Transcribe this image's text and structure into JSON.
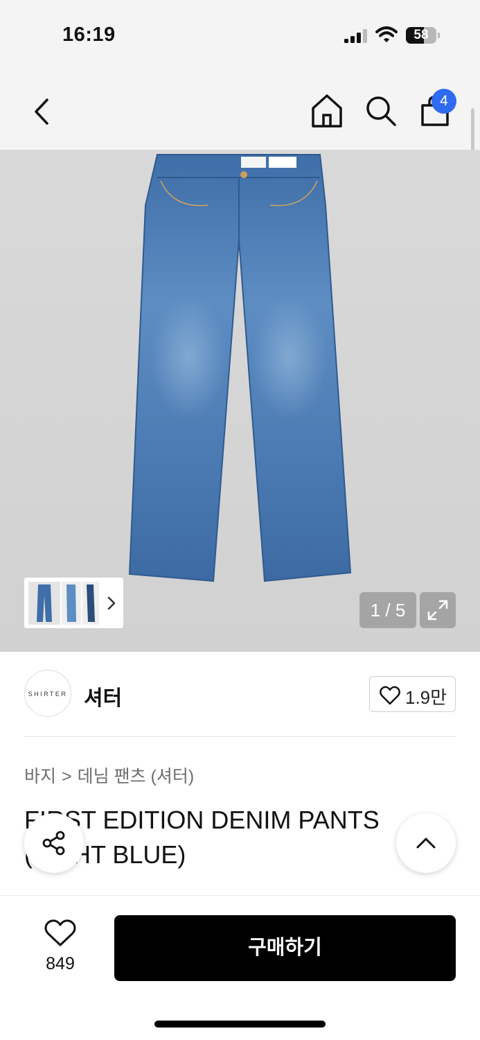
{
  "status_bar": {
    "time": "16:19",
    "battery_percent": "58",
    "battery_level": 0.58,
    "icons": [
      "signal-icon",
      "wifi-icon",
      "battery-icon"
    ]
  },
  "nav": {
    "icons": [
      "back-icon",
      "home-icon",
      "search-icon",
      "cart-icon"
    ],
    "cart_count": "4",
    "badge_color": "#2f6bf0"
  },
  "gallery": {
    "page_counter": "1 / 5",
    "current_page": 1,
    "total_pages": 5,
    "icons": [
      "chevron-right-icon",
      "expand-icon"
    ]
  },
  "seller": {
    "logo_text": "SHIRTER",
    "name": "셔터",
    "likes": "1.9만"
  },
  "breadcrumb": {
    "category": "바지",
    "separator": ">",
    "subcategory": "데님 팬츠 (셔터)"
  },
  "product": {
    "title": "FIRST EDITION DENIM PANTS (LIGHT BLUE)"
  },
  "floating": {
    "icons": [
      "share-icon",
      "chevron-up-icon"
    ]
  },
  "bottom_bar": {
    "wish_count": "849",
    "buy_label": "구매하기",
    "buy_color": "#000000"
  }
}
